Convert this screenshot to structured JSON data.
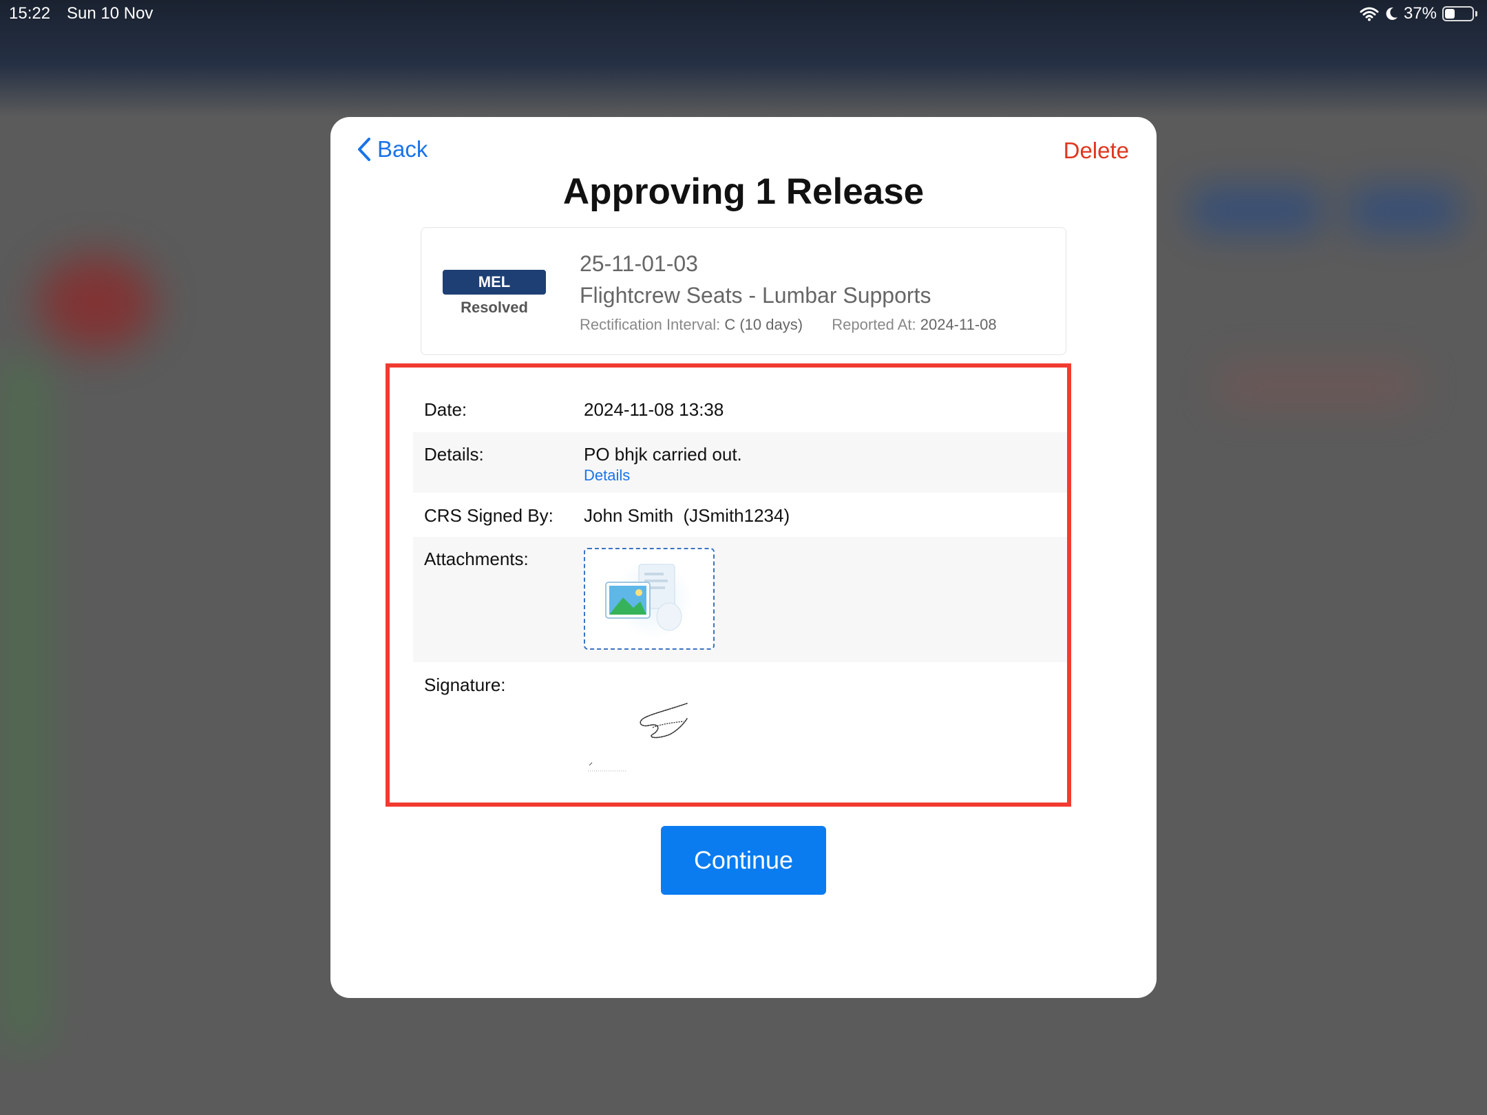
{
  "status_bar": {
    "time": "15:22",
    "date": "Sun 10 Nov",
    "battery": "37%"
  },
  "modal": {
    "back_label": "Back",
    "delete_label": "Delete",
    "title": "Approving 1 Release",
    "continue_label": "Continue"
  },
  "item": {
    "badge": "MEL",
    "status": "Resolved",
    "id": "25-11-01-03",
    "title": "Flightcrew Seats - Lumbar Supports",
    "rect_label": "Rectification Interval:",
    "rect_value": "C (10 days)",
    "reported_label": "Reported At:",
    "reported_value": "2024-11-08"
  },
  "release": {
    "date_label": "Date:",
    "date_value": "2024-11-08 13:38",
    "details_label": "Details:",
    "details_value": "PO bhjk carried out.",
    "details_link": "Details",
    "crs_label": "CRS Signed By:",
    "crs_value": "John Smith  (JSmith1234)",
    "attachments_label": "Attachments:",
    "signature_label": "Signature:"
  },
  "colors": {
    "accent": "#0a7cf0",
    "delete": "#e0361f",
    "badge": "#1e3f73",
    "highlight": "#f23b30"
  },
  "icons": {
    "back": "chevron-left-icon",
    "wifi": "wifi-icon",
    "moon": "moon-icon",
    "battery": "battery-icon",
    "attachment": "image-file-icon"
  }
}
